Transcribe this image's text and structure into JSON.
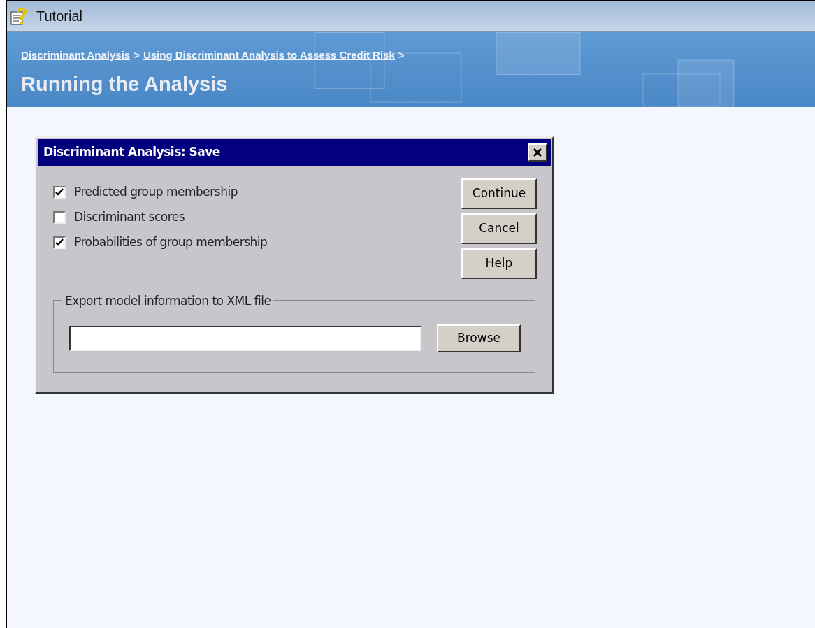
{
  "window": {
    "title": "Tutorial"
  },
  "breadcrumbs": [
    {
      "label": "Discriminant Analysis"
    },
    {
      "label": "Using Discriminant Analysis to Assess Credit Risk"
    }
  ],
  "breadcrumb_separator": ">",
  "page_title": "Running the Analysis",
  "dialog": {
    "title": "Discriminant Analysis: Save",
    "options": [
      {
        "label": "Predicted group membership",
        "checked": true
      },
      {
        "label": "Discriminant scores",
        "checked": false
      },
      {
        "label": "Probabilities of group membership",
        "checked": true
      }
    ],
    "buttons": [
      "Continue",
      "Cancel",
      "Help"
    ],
    "export_group": {
      "legend": "Export model information to XML file",
      "browse_button": "Browse"
    }
  }
}
